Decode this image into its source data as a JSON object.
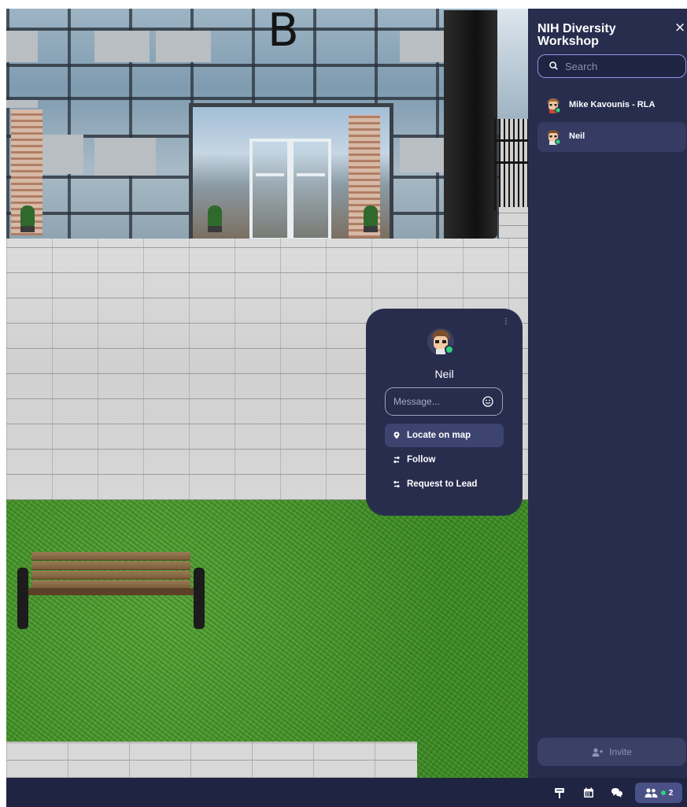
{
  "map": {
    "building_letter": "B"
  },
  "sidebar": {
    "title": "NIH Diversity Workshop",
    "close_glyph": "×",
    "search": {
      "placeholder": "Search",
      "value": ""
    },
    "users": [
      {
        "name": "Mike Kavounis - RLA",
        "status": "online",
        "selected": false
      },
      {
        "name": "Neil",
        "status": "online",
        "selected": true
      }
    ],
    "invite_label": "Invite"
  },
  "popup": {
    "user_name": "Neil",
    "more_glyph": "⋮",
    "message": {
      "placeholder": "Message...",
      "value": ""
    },
    "actions": [
      {
        "label": "Locate on map",
        "icon": "map-pin-icon",
        "active": true
      },
      {
        "label": "Follow",
        "icon": "follow-icon",
        "active": false
      },
      {
        "label": "Request to Lead",
        "icon": "request-to-lead-icon",
        "active": false
      }
    ]
  },
  "bottombar": {
    "icons": [
      "sign-post-icon",
      "calendar-icon",
      "chat-icon",
      "people-icon"
    ],
    "participant_count": "2"
  },
  "colors": {
    "panel": "#282d4e",
    "panel_highlight": "#353b62",
    "search_border": "#8f97e8",
    "online": "#2fd07a",
    "bottombar": "#1f2442",
    "people_button": "#4a5186"
  }
}
